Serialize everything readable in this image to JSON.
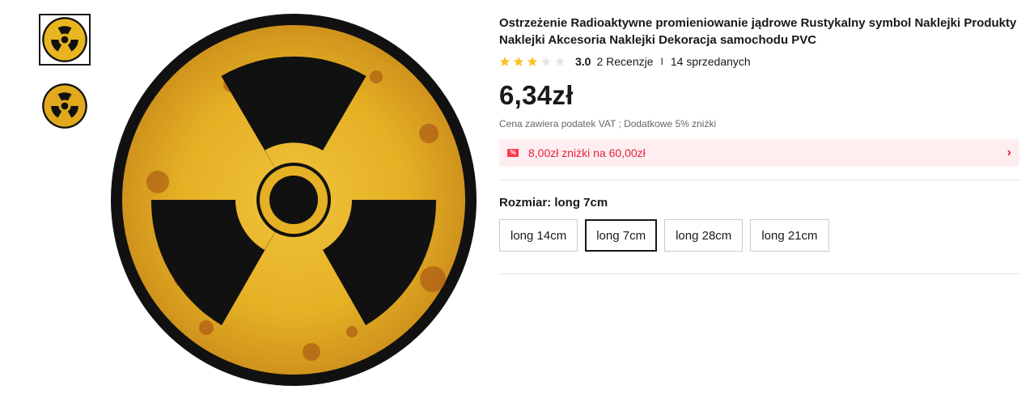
{
  "product": {
    "title": "Ostrzeżenie Radioaktywne promieniowanie jądrowe Rustykalny symbol Naklejki Produkty Naklejki Akcesoria Naklejki Dekoracja samochodu PVC",
    "rating": {
      "stars": 3,
      "max_stars": 5,
      "value": "3.0",
      "reviews": "2 Recenzje",
      "separator": "I",
      "sold": "14 sprzedanych"
    },
    "price": "6,34zł",
    "vat_note": "Cena zawiera podatek VAT ; Dodatkowe 5% zniżki",
    "coupon": {
      "icon": "%",
      "text": "8,00zł zniżki na 60,00zł",
      "chevron": "›"
    },
    "size": {
      "label": "Rozmiar: long 7cm",
      "options": [
        "long 14cm",
        "long 7cm",
        "long 28cm",
        "long 21cm"
      ],
      "selected": "long 7cm"
    }
  },
  "colors": {
    "accent_red": "#e0233d",
    "coupon_bg": "#ffeef0",
    "star": "#fcc028",
    "star_empty": "#e6e6e6",
    "sign_yellow": "#e8b520",
    "sign_black": "#111111"
  },
  "icons": {
    "rating_star": "star-icon",
    "coupon": "coupon-icon",
    "chevron": "chevron-right-icon",
    "thumbnail": "radiation-symbol"
  }
}
